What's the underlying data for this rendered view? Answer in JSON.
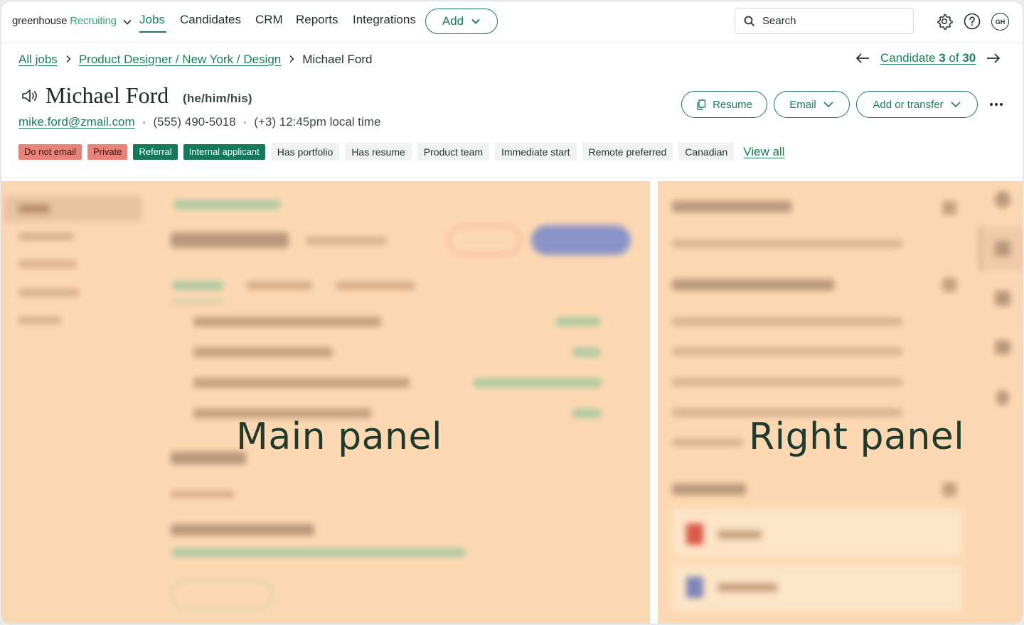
{
  "nav": {
    "logo_brand": "greenhouse",
    "logo_product": "Recruiting",
    "items": [
      {
        "label": "Jobs",
        "active": true
      },
      {
        "label": "Candidates",
        "active": false
      },
      {
        "label": "CRM",
        "active": false
      },
      {
        "label": "Reports",
        "active": false
      },
      {
        "label": "Integrations",
        "active": false
      }
    ],
    "add_label": "Add",
    "search_placeholder": "Search",
    "avatar_initials": "GH"
  },
  "breadcrumb": {
    "items": [
      "All jobs",
      "Product Designer / New York / Design"
    ],
    "current": "Michael Ford"
  },
  "candidate_nav": {
    "prefix": "Candidate ",
    "index": "3",
    "middle": " of ",
    "total": "30"
  },
  "candidate": {
    "name": "Michael Ford",
    "pronouns": "(he/him/his)",
    "email": "mike.ford@zmail.com",
    "phone": "(555) 490-5018",
    "local_time": "(+3) 12:45pm local time",
    "separator": "·"
  },
  "actions": {
    "resume": "Resume",
    "email": "Email",
    "add_transfer": "Add or transfer"
  },
  "tags": [
    {
      "label": "Do not email",
      "style": "red"
    },
    {
      "label": "Private",
      "style": "red"
    },
    {
      "label": "Referral",
      "style": "green"
    },
    {
      "label": "Internal applicant",
      "style": "green"
    },
    {
      "label": "Has portfolio",
      "style": "grey"
    },
    {
      "label": "Has resume",
      "style": "grey"
    },
    {
      "label": "Product team",
      "style": "grey"
    },
    {
      "label": "Immediate start",
      "style": "grey"
    },
    {
      "label": "Remote preferred",
      "style": "grey"
    },
    {
      "label": "Canadian",
      "style": "grey"
    }
  ],
  "view_all": "View all",
  "panels": {
    "main_label": "Main panel",
    "right_label": "Right panel"
  },
  "colors": {
    "brand_green": "#1a7d56",
    "tag_red": "#e7837b",
    "tag_green": "#14785a",
    "panel_overlay": "#fdd9b3"
  }
}
